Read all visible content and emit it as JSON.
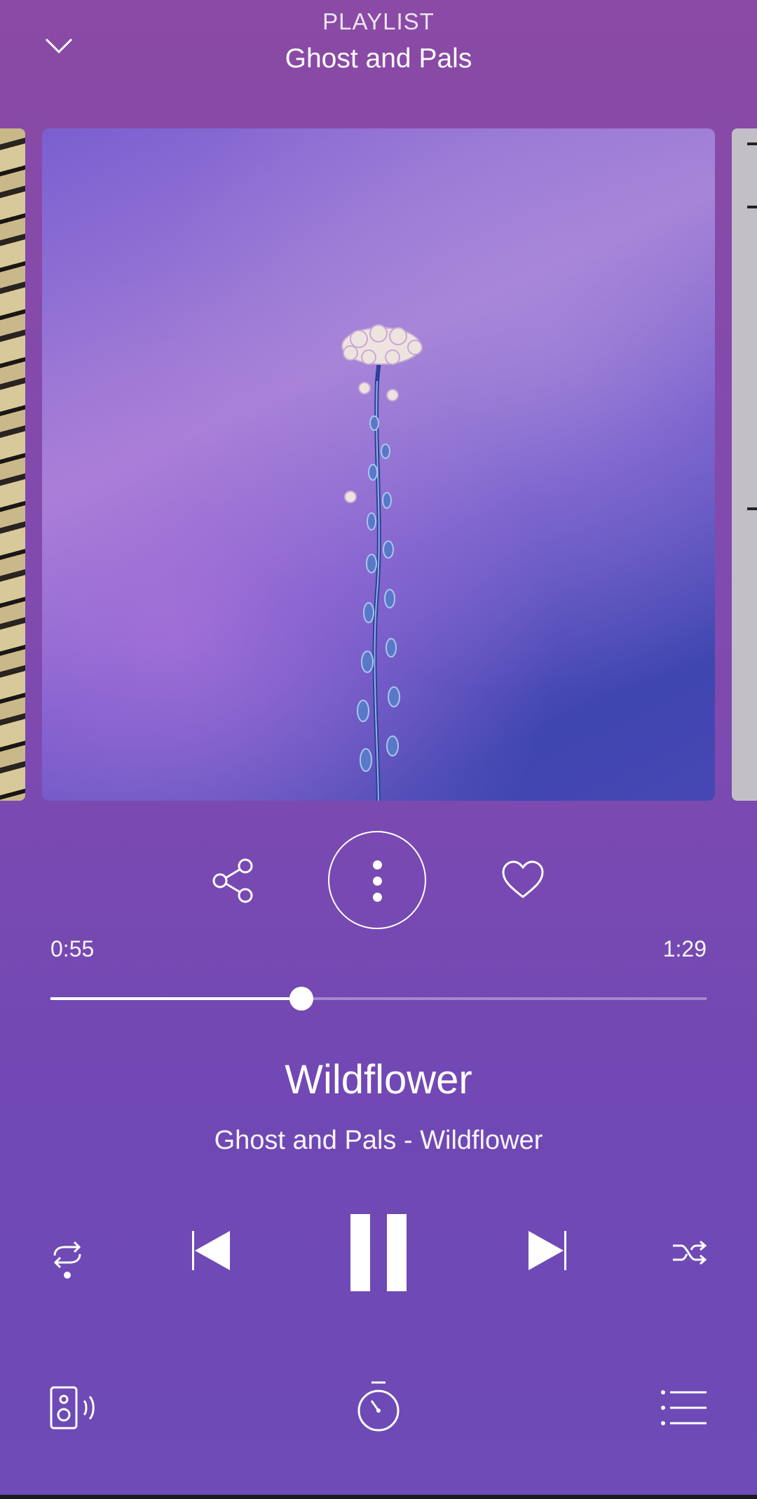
{
  "header": {
    "context_label": "PLAYLIST",
    "title": "Ghost and Pals",
    "collapse_icon": "chevron-down-icon"
  },
  "artwork": {
    "current_description_icon": "album-art",
    "colors": {
      "primary": "#7b5fd0",
      "secondary": "#3f46b0"
    }
  },
  "actions": {
    "share_icon": "share-icon",
    "more_icon": "more-vertical-icon",
    "like_icon": "heart-outline-icon"
  },
  "progress": {
    "elapsed": "0:55",
    "total": "1:29",
    "fraction": 0.382
  },
  "track": {
    "title": "Wildflower",
    "subtitle": "Ghost and Pals - Wildflower"
  },
  "controls": {
    "repeat_icon": "repeat-icon",
    "previous_icon": "skip-previous-icon",
    "pause_icon": "pause-icon",
    "next_icon": "skip-next-icon",
    "shuffle_icon": "shuffle-icon"
  },
  "bottom_bar": {
    "device_icon": "speaker-cast-icon",
    "timer_icon": "sleep-timer-icon",
    "queue_icon": "queue-list-icon"
  },
  "colors": {
    "background_top": "#8a4aa5",
    "background_bottom": "#6e4bb6",
    "foreground": "#ffffff"
  }
}
